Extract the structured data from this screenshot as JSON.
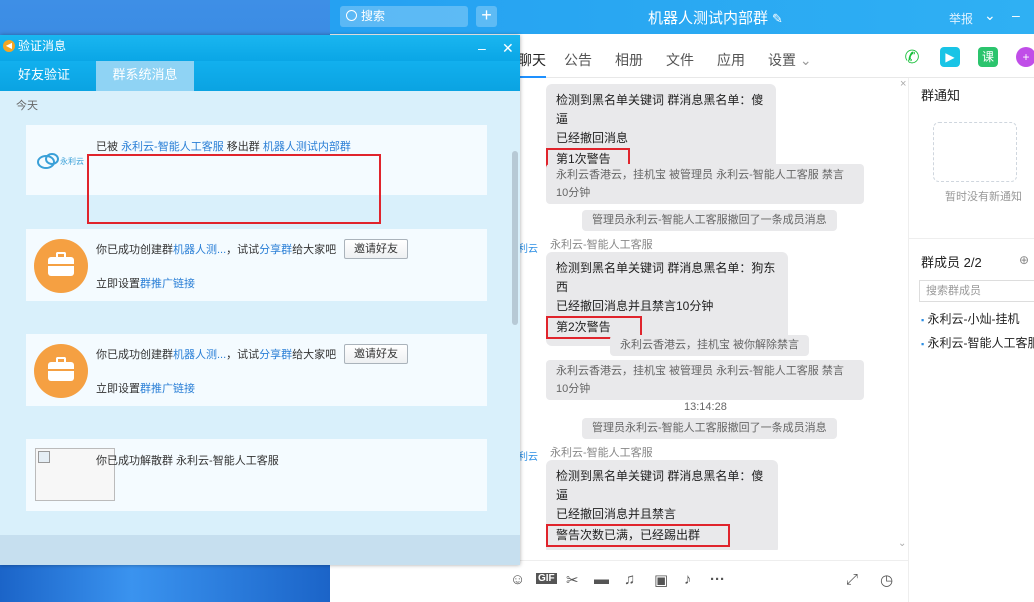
{
  "chat": {
    "search_placeholder": "搜索",
    "title": "机器人测试内部群",
    "report": "举报",
    "tabs": [
      "聊天",
      "公告",
      "相册",
      "文件",
      "应用",
      "设置"
    ],
    "tool_icons": [
      "phone-icon",
      "video-icon",
      "lesson-icon",
      "add-app-icon"
    ],
    "lesson_label": "课",
    "messages": {
      "m1_line1": "检测到黑名单关键词 群消息黑名单：傻逼",
      "m1_line2": "已经撤回消息",
      "m1_warn": "第1次警告",
      "s1": "永利云香港云，挂机宝 被管理员 永利云-智能人工客服 禁言10分钟",
      "s2": "管理员永利云-智能人工客服撤回了一条成员消息",
      "sender2": "永利云-智能人工客服",
      "m2_line1": "检测到黑名单关键词 群消息黑名单：狗东西",
      "m2_line2": "已经撤回消息并且禁言10分钟",
      "m2_warn": "第2次警告",
      "s3": "永利云香港云，挂机宝 被你解除禁言",
      "s4": "永利云香港云，挂机宝 被管理员 永利云-智能人工客服 禁言10分钟",
      "time": "13:14:28",
      "s5": "管理员永利云-智能人工客服撤回了一条成员消息",
      "sender3": "永利云-智能人工客服",
      "m3_line1": "检测到黑名单关键词 群消息黑名单：傻逼",
      "m3_line2": "已经撤回消息并且禁言",
      "m3_warn": "警告次数已满，已经踢出群",
      "avatar_label": "利云"
    },
    "input_icons": [
      "emoji-icon",
      "gif-icon",
      "scissors-icon",
      "folder-icon",
      "music-icon",
      "image-icon",
      "bell-icon",
      "more-icon"
    ],
    "gif_label": "GIF",
    "side": {
      "notice_title": "群通知",
      "notice_empty": "暂时没有新通知",
      "members_title": "群成员 2/2",
      "member_search_placeholder": "搜索群成员",
      "members": [
        "永利云-小灿-挂机",
        "永利云-智能人工客服"
      ]
    }
  },
  "verify": {
    "title": "验证消息",
    "tabs": [
      "好友验证",
      "群系统消息"
    ],
    "today": "今天",
    "logo_text": "永利云",
    "card1": {
      "prefix": "已被",
      "actor": "永利云-智能人工客服",
      "mid": "移出群",
      "group": "机器人测试内部群"
    },
    "card2": {
      "prefix": "你已成功创建群",
      "group": "机器人测...",
      "mid": "，试试",
      "share": "分享群",
      "suffix": "给大家吧",
      "button": "邀请好友",
      "setup_prefix": "立即设置",
      "setup_link": "群推广链接"
    },
    "card3": {
      "prefix": "你已成功创建群",
      "group": "机器人测...",
      "mid": "，试试",
      "share": "分享群",
      "suffix": "给大家吧",
      "button": "邀请好友",
      "setup_prefix": "立即设置",
      "setup_link": "群推广链接"
    },
    "card4": {
      "text": "你已成功解散群 永利云-智能人工客服"
    }
  }
}
